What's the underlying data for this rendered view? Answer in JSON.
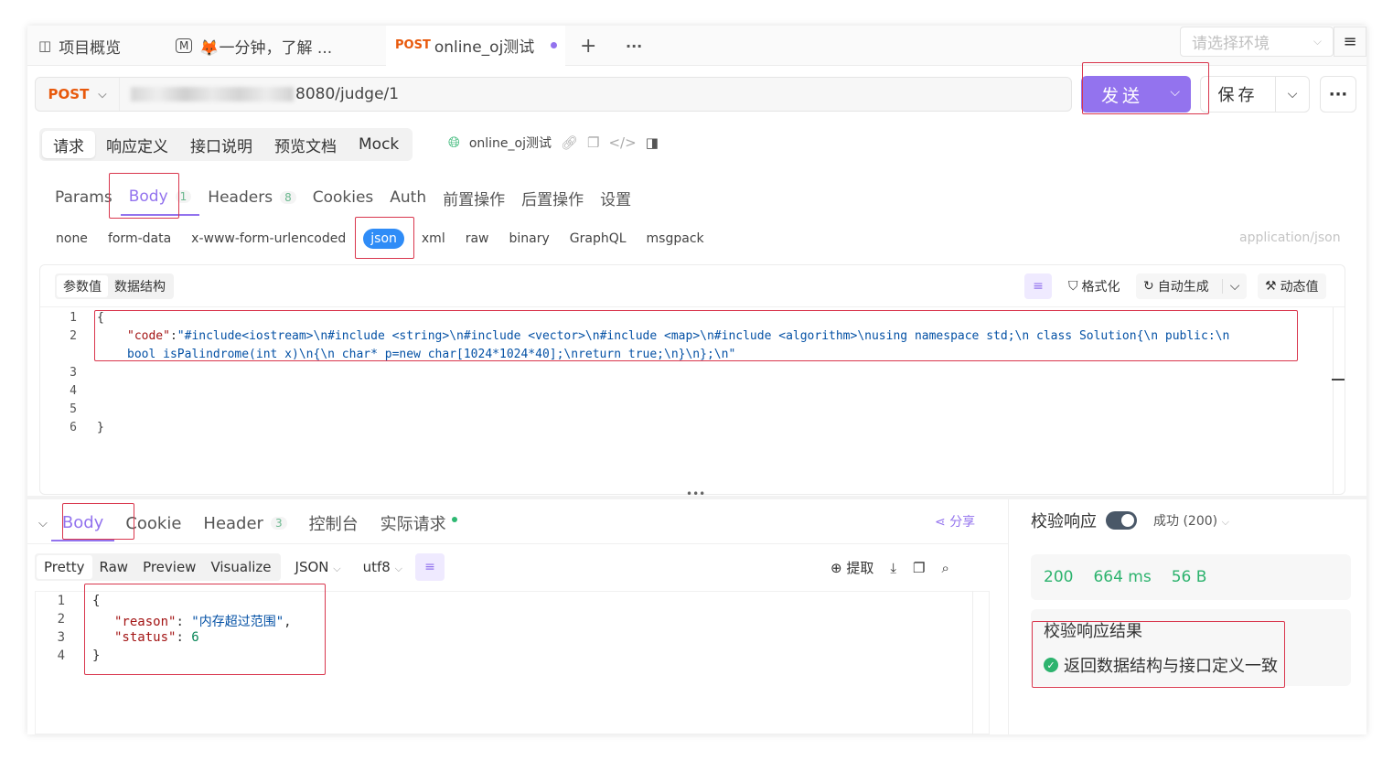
{
  "tabs": [
    {
      "label": "项目概览",
      "icon": "overview-icon"
    },
    {
      "label": "🦊一分钟，了解 ...",
      "icon": "markdown-icon"
    },
    {
      "method": "POST",
      "label": "online_oj测试"
    }
  ],
  "tab_actions": {
    "add": "+",
    "more": "···"
  },
  "env_placeholder": "请选择环境",
  "request": {
    "method": "POST",
    "url_visible": "8080/judge/1",
    "send_label": "发送",
    "save_label": "保存"
  },
  "subtabs": [
    "请求",
    "响应定义",
    "接口说明",
    "预览文档",
    "Mock"
  ],
  "api_name": "online_oj测试",
  "param_tabs": [
    {
      "label": "Params",
      "count": ""
    },
    {
      "label": "Body",
      "count": "1"
    },
    {
      "label": "Headers",
      "count": "8"
    },
    {
      "label": "Cookies",
      "count": ""
    },
    {
      "label": "Auth",
      "count": ""
    },
    {
      "label": "前置操作",
      "count": ""
    },
    {
      "label": "后置操作",
      "count": ""
    },
    {
      "label": "设置",
      "count": ""
    }
  ],
  "body_types": [
    "none",
    "form-data",
    "x-www-form-urlencoded",
    "json",
    "xml",
    "raw",
    "binary",
    "GraphQL",
    "msgpack"
  ],
  "content_type": "application/json",
  "editor": {
    "seg": [
      "参数值",
      "数据结构"
    ],
    "format_label": "格式化",
    "auto_label": "自动生成",
    "dynamic_label": "动态值",
    "lines": [
      "1",
      "2",
      "",
      "3",
      "4",
      "5",
      "6"
    ],
    "open_brace": "{",
    "code_key": "\"code\"",
    "code_value_1": "\"#include<iostream>\\n#include <string>\\n#include <vector>\\n#include <map>\\n#include <algorithm>\\nusing namespace std;\\n class Solution{\\n public:\\n",
    "code_value_2": "bool isPalindrome(int x)\\n{\\n char* p=new char[1024*1024*40];\\nreturn true;\\n}\\n};\\n\"",
    "close_brace": "}"
  },
  "response": {
    "tabs": [
      {
        "label": "Body",
        "count": ""
      },
      {
        "label": "Cookie",
        "count": ""
      },
      {
        "label": "Header",
        "count": "3"
      },
      {
        "label": "控制台",
        "count": ""
      },
      {
        "label": "实际请求",
        "count": ""
      }
    ],
    "share_label": "分享",
    "formats": [
      "Pretty",
      "Raw",
      "Preview",
      "Visualize"
    ],
    "format_type": "JSON",
    "encoding": "utf8",
    "extract_label": "提取",
    "lines": [
      "1",
      "2",
      "3",
      "4"
    ],
    "json": {
      "open": "{",
      "reason_key": "\"reason\"",
      "reason_value": "\"内存超过范围\"",
      "status_key": "\"status\"",
      "status_value": "6",
      "close": "}"
    }
  },
  "validation": {
    "title": "校验响应",
    "status": "成功 (200)",
    "code": "200",
    "time": "664 ms",
    "size": "56 B",
    "result_title": "校验响应结果",
    "result_text": "返回数据结构与接口定义一致"
  },
  "colors": {
    "accent": "#9373ee",
    "post": "#e8590c",
    "success": "#2db36e",
    "json_chip": "#2f8cf7",
    "annotation": "#d9364d"
  }
}
